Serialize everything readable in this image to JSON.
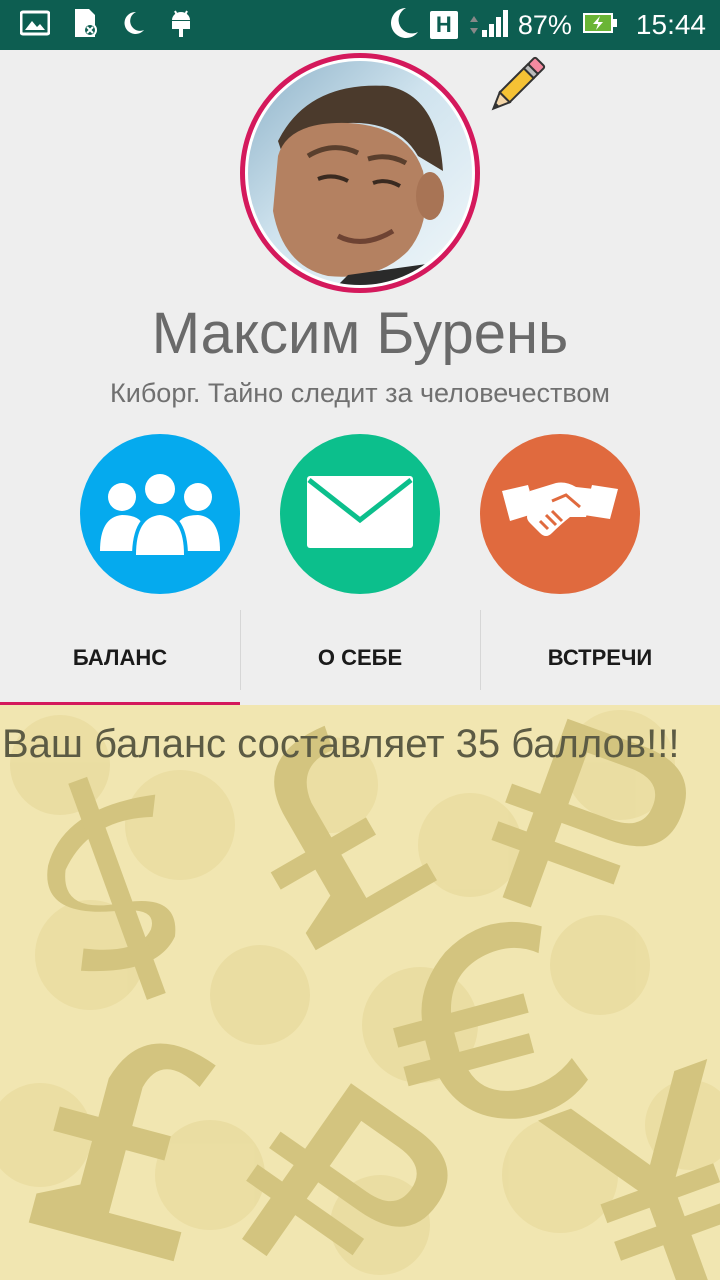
{
  "status_bar": {
    "left_icons": [
      "image-icon",
      "sd-card-icon",
      "moon-icon",
      "android-icon"
    ],
    "right_icons": [
      "moon-icon",
      "network-h-icon",
      "signal-icon",
      "battery-charging-icon"
    ],
    "network_letter": "H",
    "battery": "87%",
    "time": "15:44"
  },
  "profile": {
    "name": "Максим Бурень",
    "status": "Киборг. Тайно следит за человечеством",
    "accent_color": "#d4195c"
  },
  "actions": [
    {
      "icon": "group-icon",
      "color": "#05aaee"
    },
    {
      "icon": "envelope-icon",
      "color": "#0cbf8c"
    },
    {
      "icon": "handshake-icon",
      "color": "#e06a3e"
    }
  ],
  "tabs": {
    "balance": "БАЛАНС",
    "about": "О СЕБЕ",
    "meetings": "ВСТРЕЧИ",
    "selected": "БАЛАНС"
  },
  "content": {
    "balance_message": "Ваш баланс составляет 35 баллов!!!"
  }
}
